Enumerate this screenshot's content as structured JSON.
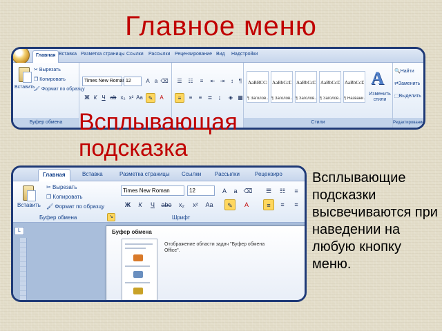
{
  "slide": {
    "title": "Главное меню",
    "tooltip_heading": "Всплывающая подсказка",
    "side_text": "Всплывающие подсказки высвечиваются при наведении на любую кнопку меню."
  },
  "colors": {
    "heading": "#c00000",
    "frame": "#1f3a77",
    "ribbon": "#dde7f4"
  },
  "ribbon": {
    "tabs": [
      "Главная",
      "Вставка",
      "Разметка страницы",
      "Ссылки",
      "Рассылки",
      "Рецензирование",
      "Вид",
      "Надстройки"
    ],
    "clipboard": {
      "paste": "Вставить",
      "cut": "Вырезать",
      "copy": "Копировать",
      "format_painter": "Формат по образцу",
      "label": "Буфер обмена"
    },
    "font": {
      "name": "Times New Roman",
      "size": "12"
    },
    "styles_label": "Стили",
    "styles": [
      {
        "sample": "AaBBCCI",
        "name": "¶ Заголов..."
      },
      {
        "sample": "AaBbCcDd",
        "name": "¶ Заголов..."
      },
      {
        "sample": "AaBbCcDd",
        "name": "¶ Заголов..."
      },
      {
        "sample": "AaBbCcDc",
        "name": "¶ Заголов..."
      },
      {
        "sample": "AaBbCcDc",
        "name": "¶ Названи..."
      }
    ],
    "change_styles": "Изменить стили",
    "editing": {
      "find": "Найти",
      "replace": "Заменить",
      "select": "Выделить",
      "label": "Редактирование"
    }
  },
  "ribbon2": {
    "tabs": [
      "Главная",
      "Вставка",
      "Разметка страницы",
      "Ссылки",
      "Рассылки",
      "Рецензиро"
    ],
    "clipboard": {
      "paste": "Вставить",
      "cut": "Вырезать",
      "copy": "Копировать",
      "format_painter": "Формат по образцу",
      "label": "Буфер обмена"
    },
    "font": {
      "name": "Times New Roman",
      "size": "12",
      "label": "Шрифт"
    },
    "ruler_corner": "L",
    "tooltip": {
      "title": "Буфер обмена",
      "description": "Отображение области задач \"Буфер обмена Office\"."
    }
  }
}
